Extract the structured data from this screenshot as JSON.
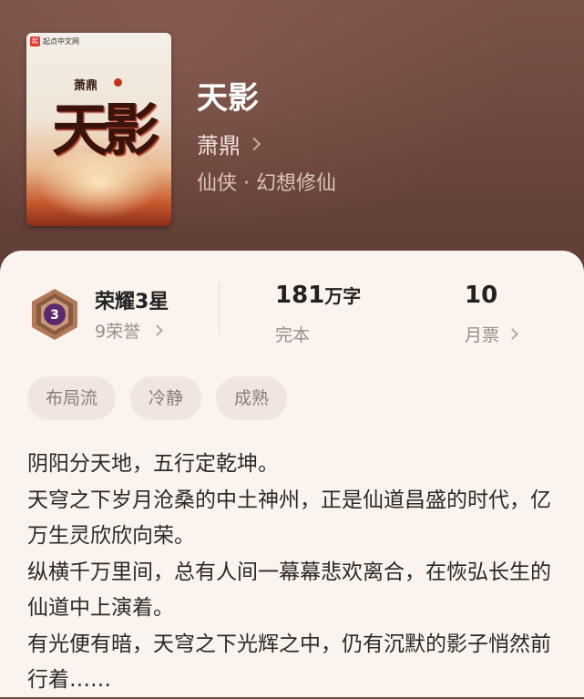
{
  "cover": {
    "publisher": "起点中文网",
    "logo_char": "起",
    "author": "萧鼎",
    "title": "天影"
  },
  "book": {
    "title": "天影",
    "author": "萧鼎",
    "genre": "仙侠 · 幻想修仙"
  },
  "rank": {
    "title": "荣耀3星",
    "badge_number": "3",
    "honors": "9荣誉"
  },
  "stats": {
    "words_value": "181",
    "words_unit": "万字",
    "status": "完本",
    "votes_value": "10",
    "votes_label": "月票"
  },
  "tags": [
    "布局流",
    "冷静",
    "成熟"
  ],
  "description": [
    "阴阳分天地，五行定乾坤。",
    "天穹之下岁月沧桑的中土神州，正是仙道昌盛的时代，亿万生灵欣欣向荣。",
    "纵横千万里间，总有人间一幕幕悲欢离合，在恢弘长生的仙道中上演着。",
    "有光便有暗，天穹之下光辉之中，仍有沉默的影子悄然前行着……"
  ],
  "colors": {
    "hero_bg": "#6e4a3f",
    "card_bg": "#fbf3ee",
    "badge_purple": "#5b2a6e",
    "badge_bronze": "#b07a5a"
  },
  "icons": [
    "chevron-right-icon",
    "rank-badge-icon"
  ]
}
